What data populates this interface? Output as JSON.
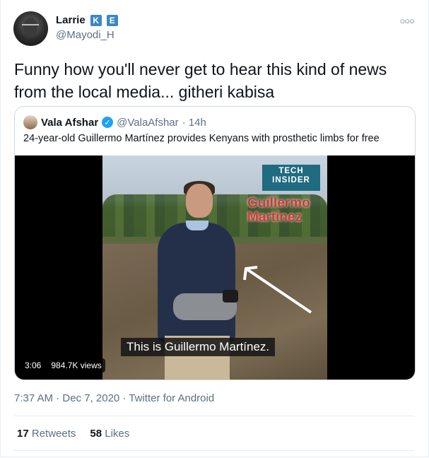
{
  "author": {
    "name": "Larrie",
    "badges": [
      "K",
      "E"
    ],
    "handle": "@Mayodi_H"
  },
  "tweet": {
    "text": "Funny how you'll never get to hear this kind of news from the local media... githeri kabisa"
  },
  "quoted": {
    "name": "Vala Afshar",
    "handle": "@ValaAfshar",
    "time": "· 14h",
    "text": "24-year-old Guillermo Martínez provides Kenyans with prosthetic limbs for free",
    "video": {
      "brand_line1": "TECH",
      "brand_line2": "INSIDER",
      "overlay_name_line1": "Guillermo",
      "overlay_name_line2": "Martínez",
      "caption": "This is Guillermo Martínez.",
      "duration": "3:06",
      "views": "984.7K views"
    }
  },
  "meta": {
    "timestamp": "7:37 AM · Dec 7, 2020 · Twitter for Android"
  },
  "stats": {
    "retweets_count": "17",
    "retweets_label": "Retweets",
    "likes_count": "58",
    "likes_label": "Likes"
  },
  "icons": {
    "more": "more-icon",
    "verified": "verified-badge-icon"
  },
  "colors": {
    "accent": "#1da1f2",
    "secondary_text": "#5b7083",
    "brand_badge": "#1f6b80",
    "overlay_red": "#d93636"
  }
}
